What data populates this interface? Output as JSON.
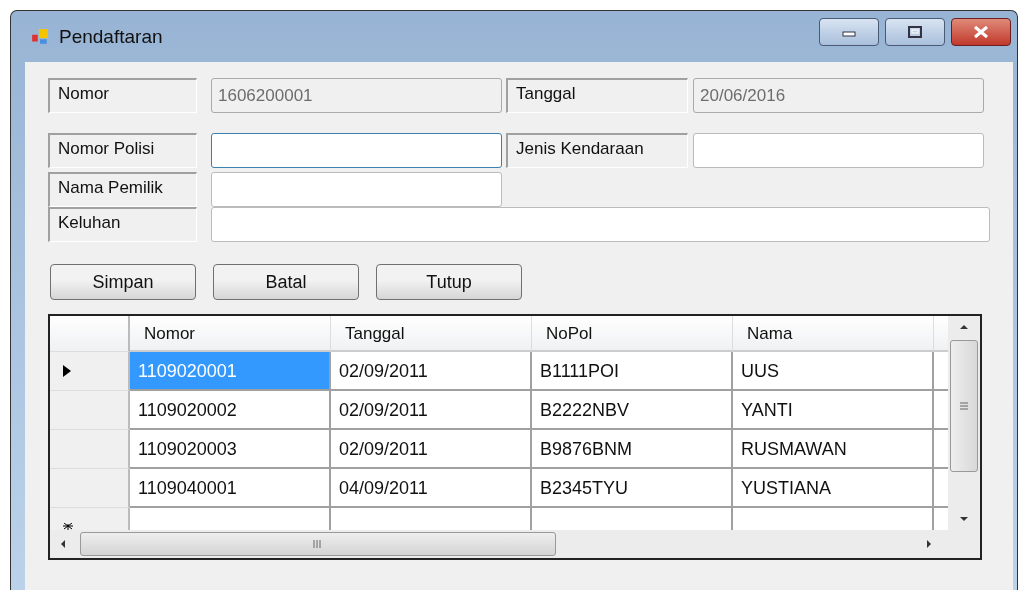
{
  "window": {
    "title": "Pendaftaran"
  },
  "fields": [
    {
      "label": "Nomor",
      "value": "1606200001",
      "disabled": true,
      "focused": false
    },
    {
      "label": "Tanggal",
      "value": "20/06/2016",
      "disabled": true,
      "focused": false
    },
    {
      "label": "Nomor Polisi",
      "disabled": false,
      "focused": true
    },
    {
      "label": "Jenis Kendaraan",
      "disabled": false,
      "focused": false
    },
    {
      "label": "Nama Pemilik",
      "disabled": false,
      "focused": false
    },
    {
      "label": "Keluhan",
      "disabled": false,
      "focused": false
    }
  ],
  "buttons": [
    "Simpan",
    "Batal",
    "Tutup"
  ],
  "table": {
    "columns": [
      "Nomor",
      "Tanggal",
      "NoPol",
      "Nama"
    ],
    "rows": [
      {
        "cells": [
          "1109020001",
          "02/09/2011",
          "B1111POI",
          "UUS"
        ],
        "selected": true
      },
      {
        "cells": [
          "1109020002",
          "02/09/2011",
          "B2222NBV",
          "YANTI"
        ],
        "selected": false
      },
      {
        "cells": [
          "1109020003",
          "02/09/2011",
          "B9876BNM",
          "RUSMAWAN"
        ],
        "selected": false
      },
      {
        "cells": [
          "1109040001",
          "04/09/2011",
          "B2345TYU",
          "YUSTIANA"
        ],
        "selected": false
      }
    ]
  }
}
